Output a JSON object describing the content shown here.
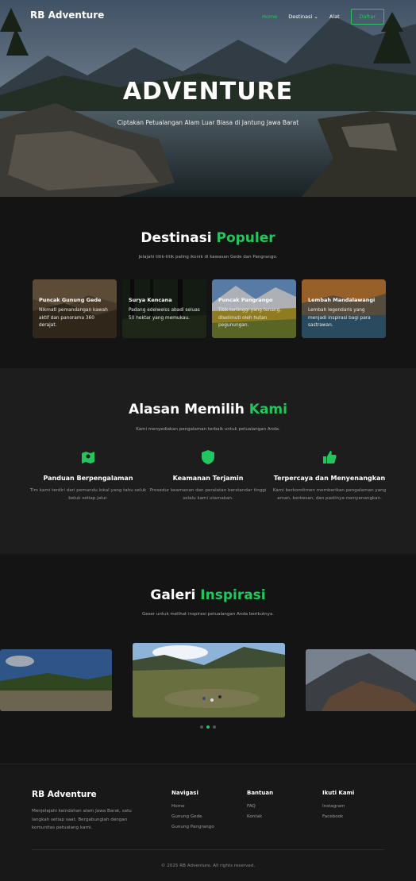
{
  "nav": {
    "brand": "RB Adventure",
    "links": [
      "Home",
      "Destinasi",
      "Alat"
    ],
    "signup": "Daftar"
  },
  "hero": {
    "title": "ADVENTURE",
    "subtitle": "Ciptakan Petualangan Alam Luar Biasa di Jantung Jawa Barat"
  },
  "destinations": {
    "title_a": "Destinasi",
    "title_b": "Populer",
    "subtitle": "Jelajahi titik-titik paling ikonik di kawasan Gede dan Pangrango.",
    "cards": [
      {
        "name": "Puncak Gunung Gede",
        "desc": "Nikmati pemandangan kawah aktif dan panorama 360 derajat."
      },
      {
        "name": "Surya Kencana",
        "desc": "Padang edelweiss abadi seluas 50 hektar yang memukau."
      },
      {
        "name": "Puncak Pangrango",
        "desc": "Titik tertinggi yang tenang, diselimuti oleh hutan pegunungan."
      },
      {
        "name": "Lembah Mandalawangi",
        "desc": "Lembah legendaris yang menjadi inspirasi bagi para sastrawan."
      }
    ]
  },
  "why": {
    "title_a": "Alasan Memilih",
    "title_b": "Kami",
    "subtitle": "Kami menyediakan pengalaman terbaik untuk petualangan Anda.",
    "features": [
      {
        "icon": "map-icon",
        "title": "Panduan Berpengalaman",
        "desc": "Tim kami terdiri dari pemandu lokal yang tahu seluk beluk setiap jalur."
      },
      {
        "icon": "shield-icon",
        "title": "Keamanan Terjamin",
        "desc": "Prosedur keamanan dan peralatan berstandar tinggi selalu kami utamakan."
      },
      {
        "icon": "thumbs-up-icon",
        "title": "Terpercaya dan Menyenangkan",
        "desc": "Kami berkomitmen memberikan pengalaman yang aman, berkesan, dan pastinya menyenangkan."
      }
    ]
  },
  "gallery": {
    "title_a": "Galeri",
    "title_b": "Inspirasi",
    "subtitle": "Geser untuk melihat inspirasi petualangan Anda berikutnya.",
    "active_slide": 1
  },
  "footer": {
    "brand": "RB Adventure",
    "desc": "Menjelajahi keindahan alam Jawa Barat, satu langkah setiap saat. Bergabunglah dengan komunitas petualang kami.",
    "nav_title": "Navigasi",
    "nav_links": [
      "Home",
      "Gunung Gede",
      "Gunung Pangrango"
    ],
    "help_title": "Bantuan",
    "help_links": [
      "FAQ",
      "Kontak"
    ],
    "follow_title": "Ikuti Kami",
    "follow_links": [
      "Instagram",
      "Facebook"
    ],
    "copyright": "© 2025 RB Adventure. All rights reserved."
  },
  "colors": {
    "accent": "#22c55e",
    "bg": "#141414",
    "alt_bg": "#1d1d1d"
  }
}
